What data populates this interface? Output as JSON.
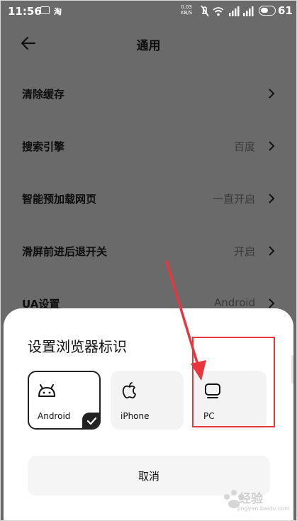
{
  "status_bar": {
    "time": "11:56",
    "app_mark": "淘",
    "net_speed_value": "0.03",
    "net_speed_unit": "KB/S",
    "battery": "61",
    "icons": [
      "image-icon",
      "mute-icon",
      "wifi-icon",
      "signal-icon",
      "signal-icon",
      "battery-icon"
    ]
  },
  "header": {
    "title": "通用"
  },
  "settings": [
    {
      "label": "清除缓存",
      "value": ""
    },
    {
      "label": "搜索引擎",
      "value": "百度"
    },
    {
      "label": "智能预加载网页",
      "value": "一直开启"
    },
    {
      "label": "滑屏前进后退开关",
      "value": "开启"
    },
    {
      "label": "UA设置",
      "value": "Android"
    }
  ],
  "sheet": {
    "title": "设置浏览器标识",
    "options": [
      {
        "label": "Android",
        "icon": "android-icon",
        "selected": true
      },
      {
        "label": "iPhone",
        "icon": "apple-icon",
        "selected": false
      },
      {
        "label": "PC",
        "icon": "monitor-icon",
        "selected": false
      }
    ],
    "cancel_label": "取消"
  },
  "colors": {
    "annotation": "#e8353e",
    "overlay": "#6a6a6a",
    "sheet": "#ffffff"
  },
  "watermark": {
    "brand": "经验",
    "url": "jingyan.baidu.com"
  }
}
